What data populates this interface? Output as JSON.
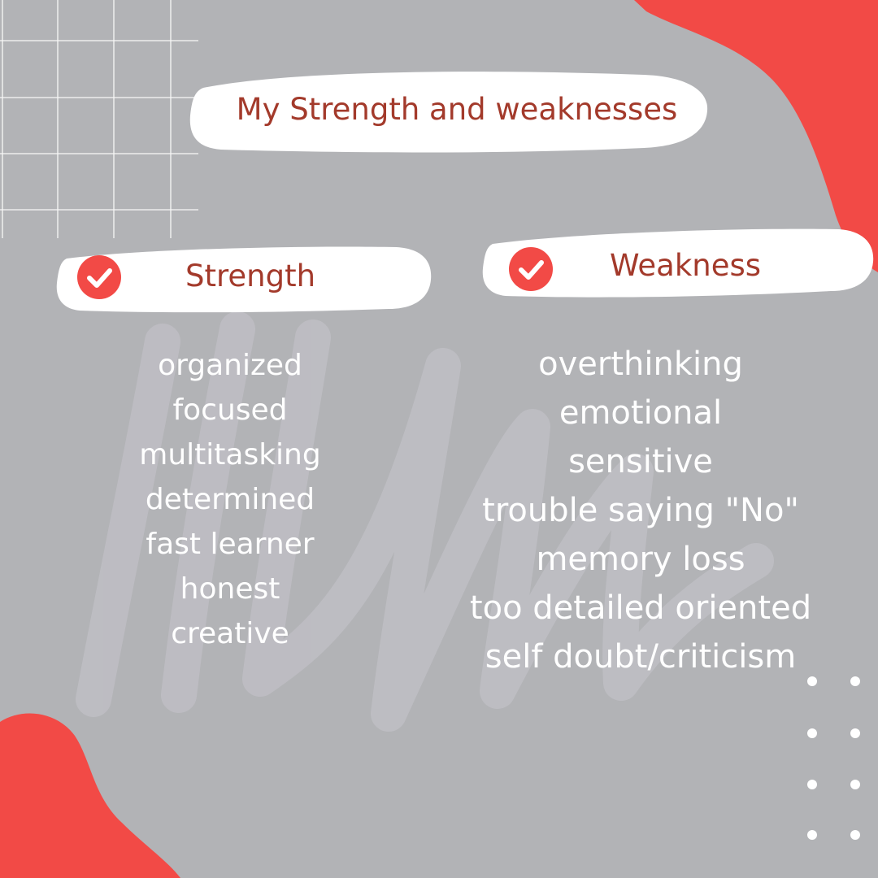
{
  "title": "My Strength and weaknesses",
  "strength": {
    "heading": "Strength",
    "items": [
      "organized",
      "focused",
      "multitasking",
      "determined",
      "fast learner",
      "honest",
      "creative"
    ]
  },
  "weakness": {
    "heading": "Weakness",
    "items": [
      "overthinking",
      "emotional",
      "sensitive",
      "trouble saying \"No\"",
      "memory loss",
      "too detailed oriented",
      "self doubt/criticism"
    ]
  },
  "colors": {
    "background": "#b2b3b6",
    "accent_red": "#f24a46",
    "heading_text": "#a33a2b",
    "list_text": "#ffffff",
    "pill": "#ffffff"
  },
  "icons": {
    "heading_marker": "check-circle-icon"
  }
}
